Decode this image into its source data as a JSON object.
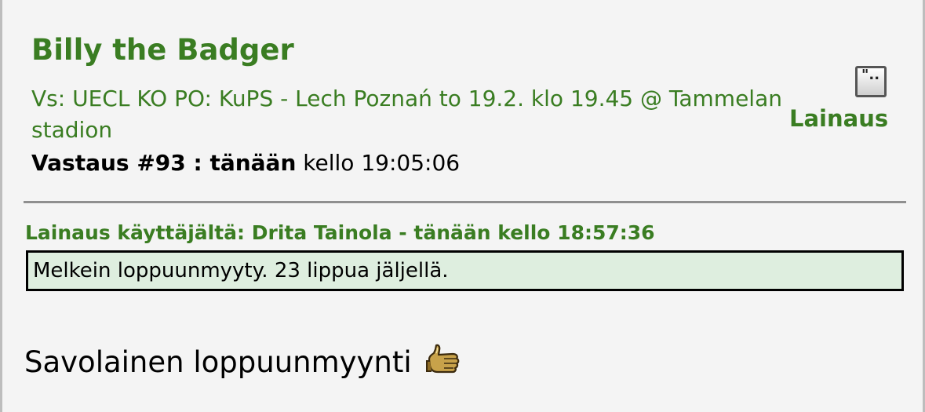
{
  "post": {
    "author": "Billy the Badger",
    "subject": "Vs: UECL KO PO: KuPS - Lech Poznań to 19.2. klo 19.45 @ Tammelan stadion",
    "reply_label": "Vastaus #93 : tänään",
    "reply_time": " kello 19:05:06",
    "quote_button": "Lainaus",
    "quote_header": "Lainaus käyttäjältä: Drita Tainola - tänään kello 18:57:36",
    "quote_text": "Melkein loppuunmyyty. 23 lippua jäljellä.",
    "message_text": "Savolainen loppuunmyynti",
    "quote_icon": "quote-icon",
    "emoticon": "thumbs-up-icon"
  },
  "colors": {
    "green": "#3a7d22",
    "quote_background": "#deeedf",
    "page_background": "#f4f4f4"
  }
}
